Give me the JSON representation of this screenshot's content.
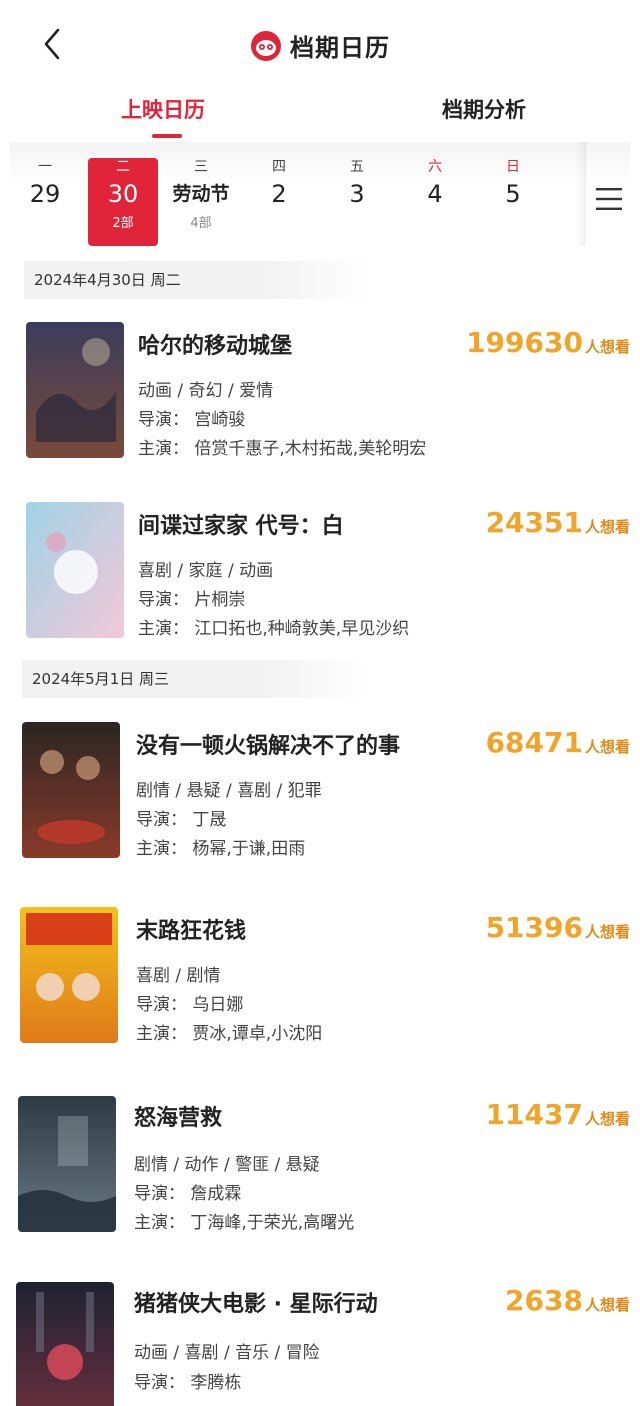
{
  "header": {
    "title": "档期日历"
  },
  "tabs": [
    {
      "label": "上映日历",
      "active": true
    },
    {
      "label": "档期分析",
      "active": false
    }
  ],
  "days": [
    {
      "weekday": "一",
      "number": "29",
      "sub": ""
    },
    {
      "weekday": "二",
      "number": "30",
      "sub": "2部",
      "selected": true
    },
    {
      "weekday": "三",
      "number": "劳动节",
      "sub": "4部"
    },
    {
      "weekday": "四",
      "number": "2",
      "sub": ""
    },
    {
      "weekday": "五",
      "number": "3",
      "sub": ""
    },
    {
      "weekday": "六",
      "number": "4",
      "sub": "",
      "weekend": true
    },
    {
      "weekday": "日",
      "number": "5",
      "sub": "",
      "weekend": true
    }
  ],
  "sections": [
    {
      "date_label": "2024年4月30日  周二"
    },
    {
      "date_label": "2024年5月1日  周三"
    }
  ],
  "movies": [
    {
      "title": "哈尔的移动城堡",
      "genre": "动画 / 奇幻 / 爱情",
      "director": "导演：  宫崎骏",
      "cast": "主演：  倍赏千惠子,木村拓哉,美轮明宏",
      "count": "199630",
      "unit": "人想看",
      "poster_colors": [
        "#3a3d5c",
        "#7a4a3a"
      ]
    },
    {
      "title": "间谍过家家 代号：白",
      "genre": "喜剧 / 家庭 / 动画",
      "director": "导演：  片桐崇",
      "cast": "主演：  江口拓也,种崎敦美,早见沙织",
      "count": "24351",
      "unit": "人想看",
      "poster_colors": [
        "#9fd3e6",
        "#f3c8d8"
      ]
    },
    {
      "title": "没有一顿火锅解决不了的事",
      "genre": "剧情 / 悬疑 / 喜剧 / 犯罪",
      "director": "导演：  丁晟",
      "cast": "主演：  杨幂,于谦,田雨",
      "count": "68471",
      "unit": "人想看",
      "poster_colors": [
        "#2b2622",
        "#8a3a2a"
      ]
    },
    {
      "title": "末路狂花钱",
      "genre": "喜剧 / 剧情",
      "director": "导演：  乌日娜",
      "cast": "主演：  贾冰,谭卓,小沈阳",
      "count": "51396",
      "unit": "人想看",
      "poster_colors": [
        "#f2c21a",
        "#e07a1a"
      ]
    },
    {
      "title": "怒海营救",
      "genre": "剧情 / 动作 / 警匪 / 悬疑",
      "director": "导演：  詹成霖",
      "cast": "主演：  丁海峰,于荣光,高曙光",
      "count": "11437",
      "unit": "人想看",
      "poster_colors": [
        "#2c3a44",
        "#6a7a84"
      ]
    },
    {
      "title": "猪猪侠大电影 · 星际行动",
      "genre": "动画 / 喜剧 / 音乐 / 冒险",
      "director": "导演：  李腾栋",
      "cast": "",
      "count": "2638",
      "unit": "人想看",
      "poster_colors": [
        "#1e2230",
        "#6a3040"
      ]
    }
  ]
}
